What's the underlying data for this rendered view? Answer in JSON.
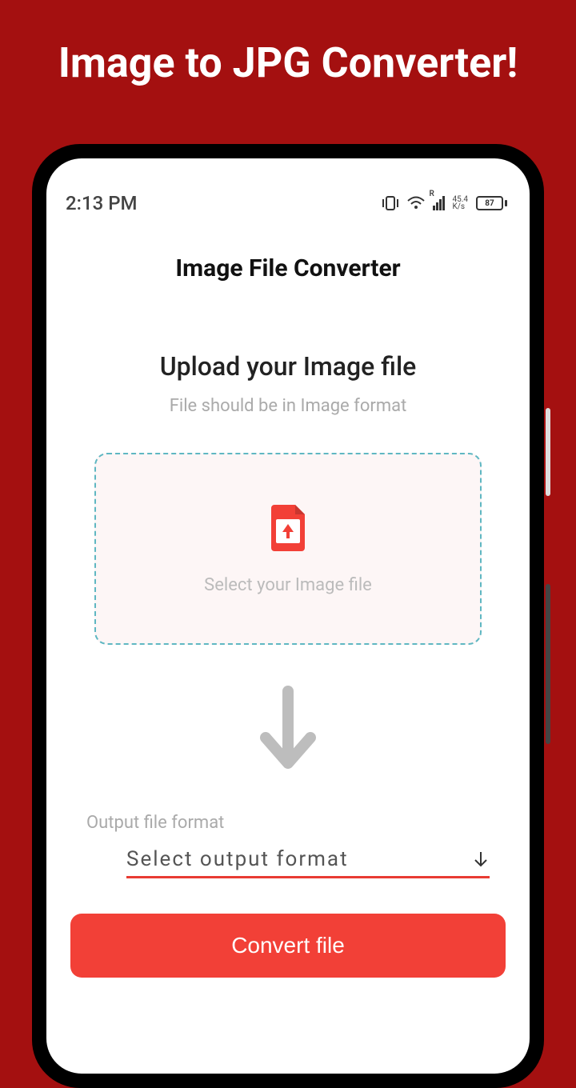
{
  "promo": {
    "title": "Image to JPG Converter!"
  },
  "status": {
    "time": "2:13 PM",
    "net_rate": "45.4",
    "net_unit": "K/s",
    "battery": "87",
    "net_letter": "R"
  },
  "app": {
    "title": "Image File Converter"
  },
  "upload": {
    "heading": "Upload your Image file",
    "subtext": "File should be in Image format",
    "dropzone_text": "Select your Image file"
  },
  "output": {
    "label": "Output file format",
    "placeholder": "Select output format"
  },
  "convert": {
    "label": "Convert file"
  }
}
